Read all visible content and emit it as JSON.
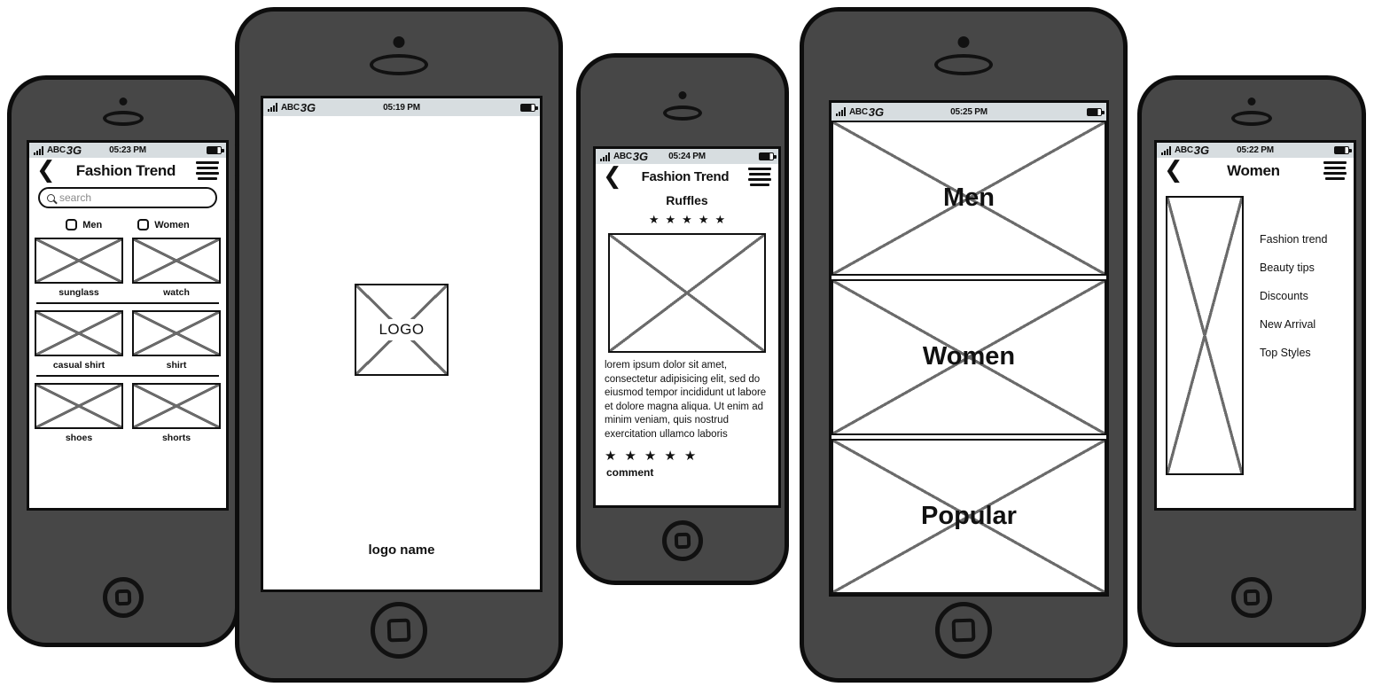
{
  "theme": {
    "frame": "#474747",
    "outline": "#0d0d0d",
    "statusbar_bg": "#d7dde0",
    "placeholder_x": "#6b6b6b"
  },
  "phones": {
    "catalog": {
      "status": {
        "carrier": "ABC",
        "network": "3G",
        "time": "05:23 PM"
      },
      "nav": {
        "back": "❮",
        "title": "Fashion Trend",
        "menu": "hamburger-icon"
      },
      "search": {
        "placeholder": "search",
        "value": ""
      },
      "filters": [
        {
          "label": "Men",
          "checked": false
        },
        {
          "label": "Women",
          "checked": false
        }
      ],
      "grid_rows": [
        [
          {
            "caption": "sunglass"
          },
          {
            "caption": "watch"
          }
        ],
        [
          {
            "caption": "casual shirt"
          },
          {
            "caption": "shirt"
          }
        ],
        [
          {
            "caption": "shoes"
          },
          {
            "caption": "shorts"
          }
        ]
      ]
    },
    "splash": {
      "status": {
        "carrier": "ABC",
        "network": "3G",
        "time": "05:19 PM"
      },
      "logo_label": "LOGO",
      "logo_name": "logo name"
    },
    "detail": {
      "status": {
        "carrier": "ABC",
        "network": "3G",
        "time": "05:24 PM"
      },
      "nav": {
        "back": "❮",
        "title": "Fashion Trend",
        "menu": "hamburger-icon"
      },
      "product_title": "Ruffles",
      "rating": 5,
      "rating_max": 5,
      "description": "lorem ipsum dolor sit amet, consectetur adipisicing elit, sed do eiusmod tempor incididunt ut labore et dolore magna aliqua. Ut enim ad minim veniam, quis nostrud exercitation ullamco laboris",
      "comment_rating": 5,
      "comment_label": "comment"
    },
    "categories": {
      "status": {
        "carrier": "ABC",
        "network": "3G",
        "time": "05:25 PM"
      },
      "panels": [
        {
          "caption": "Men"
        },
        {
          "caption": "Women"
        },
        {
          "caption": "Popular"
        }
      ]
    },
    "women_menu": {
      "status": {
        "carrier": "ABC",
        "network": "3G",
        "time": "05:22 PM"
      },
      "nav": {
        "back": "❮",
        "title": "Women",
        "menu": "hamburger-icon"
      },
      "menu_items": [
        {
          "label": "Fashion trend"
        },
        {
          "label": "Beauty tips"
        },
        {
          "label": "Discounts"
        },
        {
          "label": "New Arrival"
        },
        {
          "label": "Top Styles"
        }
      ]
    }
  }
}
